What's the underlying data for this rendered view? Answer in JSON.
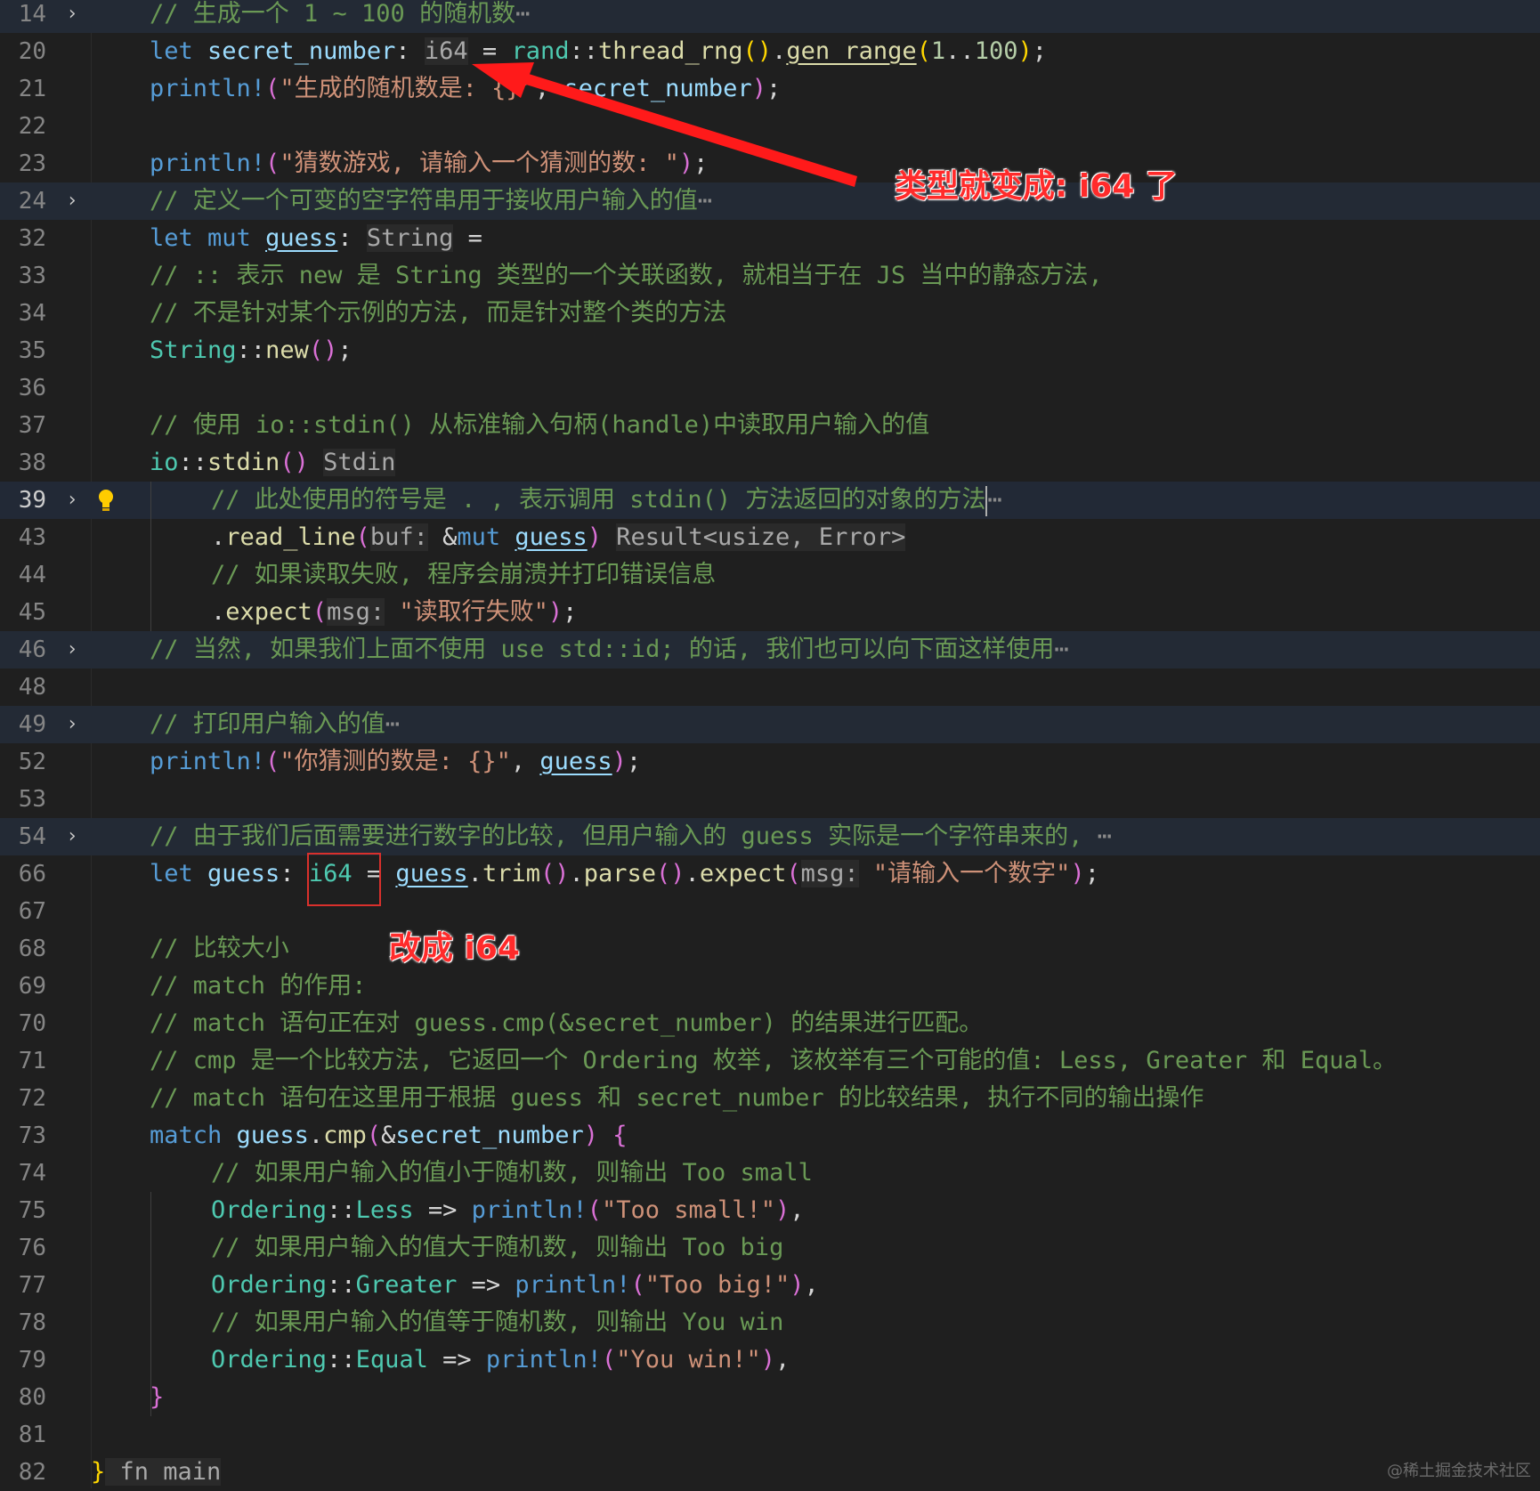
{
  "editor": {
    "lines": [
      {
        "n": "14",
        "fold": true,
        "folded_bg": true,
        "indent": 1,
        "tokens": [
          [
            "t-cm",
            "// 生成一个 1 ~ 100 的随机数"
          ],
          [
            "ell",
            "⋯"
          ]
        ]
      },
      {
        "n": "20",
        "indent": 1,
        "tokens": [
          [
            "t-kw",
            "let "
          ],
          [
            "t-var",
            "secret_number"
          ],
          [
            "",
            ": "
          ],
          [
            "t-hint",
            "i64"
          ],
          [
            "",
            " = "
          ],
          [
            "t-type",
            "rand"
          ],
          [
            "",
            "::"
          ],
          [
            "t-fn",
            "thread_rng"
          ],
          [
            "t-yb",
            "()"
          ],
          [
            "",
            "."
          ],
          [
            "t-fn ul",
            "gen_range"
          ],
          [
            "t-yb",
            "("
          ],
          [
            "t-num",
            "1"
          ],
          [
            "",
            ".."
          ],
          [
            "t-num",
            "100"
          ],
          [
            "t-yb",
            ")"
          ],
          [
            "",
            ";"
          ]
        ]
      },
      {
        "n": "21",
        "indent": 1,
        "tokens": [
          [
            "t-kw",
            "println!"
          ],
          [
            "t-paren",
            "("
          ],
          [
            "t-str",
            "\"生成的随机数是: {}\""
          ],
          [
            "",
            ", "
          ],
          [
            "t-var",
            "secret_number"
          ],
          [
            "t-paren",
            ")"
          ],
          [
            "",
            ";"
          ]
        ]
      },
      {
        "n": "22",
        "indent": 1,
        "tokens": []
      },
      {
        "n": "23",
        "indent": 1,
        "tokens": [
          [
            "t-kw",
            "println!"
          ],
          [
            "t-paren",
            "("
          ],
          [
            "t-str",
            "\"猜数游戏, 请输入一个猜测的数: \""
          ],
          [
            "t-paren",
            ")"
          ],
          [
            "",
            ";"
          ]
        ]
      },
      {
        "n": "24",
        "fold": true,
        "folded_bg": true,
        "indent": 1,
        "tokens": [
          [
            "t-cm",
            "// 定义一个可变的空字符串用于接收用户输入的值"
          ],
          [
            "ell",
            "⋯"
          ]
        ]
      },
      {
        "n": "32",
        "indent": 1,
        "tokens": [
          [
            "t-kw",
            "let "
          ],
          [
            "t-kw",
            "mut "
          ],
          [
            "t-var ul",
            "guess"
          ],
          [
            "",
            ": "
          ],
          [
            "t-hint",
            "String"
          ],
          [
            "",
            " ="
          ]
        ]
      },
      {
        "n": "33",
        "indent": 1,
        "tokens": [
          [
            "t-cm",
            "// :: 表示 new 是 String 类型的一个关联函数, 就相当于在 JS 当中的静态方法,"
          ]
        ]
      },
      {
        "n": "34",
        "indent": 1,
        "tokens": [
          [
            "t-cm",
            "// 不是针对某个示例的方法, 而是针对整个类的方法"
          ]
        ]
      },
      {
        "n": "35",
        "indent": 1,
        "tokens": [
          [
            "t-type",
            "String"
          ],
          [
            "",
            "::"
          ],
          [
            "t-fn",
            "new"
          ],
          [
            "t-paren",
            "()"
          ],
          [
            "",
            ";"
          ]
        ]
      },
      {
        "n": "36",
        "indent": 1,
        "tokens": []
      },
      {
        "n": "37",
        "indent": 1,
        "tokens": [
          [
            "t-cm",
            "// 使用 io::stdin() 从标准输入句柄(handle)中读取用户输入的值"
          ]
        ]
      },
      {
        "n": "38",
        "indent": 1,
        "tokens": [
          [
            "t-type",
            "io"
          ],
          [
            "",
            "::"
          ],
          [
            "t-fn",
            "stdin"
          ],
          [
            "t-paren",
            "()"
          ],
          [
            "",
            " "
          ],
          [
            "t-hint",
            "Stdin"
          ]
        ]
      },
      {
        "n": "39",
        "fold": true,
        "current": true,
        "active": true,
        "bulb": true,
        "indent": 2,
        "tokens": [
          [
            "t-cm",
            "// 此处使用的符号是 . , 表示调用 stdin() 方法返回的对象的方法"
          ],
          [
            "cursor",
            ""
          ],
          [
            "ell",
            "⋯"
          ]
        ]
      },
      {
        "n": "43",
        "indent": 2,
        "tokens": [
          [
            "",
            "."
          ],
          [
            "t-fn",
            "read_line"
          ],
          [
            "t-paren",
            "("
          ],
          [
            "t-hint",
            "buf:"
          ],
          [
            "",
            " &"
          ],
          [
            "t-kw",
            "mut "
          ],
          [
            "t-var ul",
            "guess"
          ],
          [
            "t-paren",
            ")"
          ],
          [
            "",
            " "
          ],
          [
            "t-hint",
            "Result<usize, Error>"
          ]
        ]
      },
      {
        "n": "44",
        "indent": 2,
        "tokens": [
          [
            "t-cm",
            "// 如果读取失败, 程序会崩溃并打印错误信息"
          ]
        ]
      },
      {
        "n": "45",
        "indent": 2,
        "tokens": [
          [
            "",
            "."
          ],
          [
            "t-fn",
            "expect"
          ],
          [
            "t-paren",
            "("
          ],
          [
            "t-hint",
            "msg:"
          ],
          [
            "",
            " "
          ],
          [
            "t-str",
            "\"读取行失败\""
          ],
          [
            "t-paren",
            ")"
          ],
          [
            "",
            ";"
          ]
        ]
      },
      {
        "n": "46",
        "fold": true,
        "folded_bg": true,
        "indent": 1,
        "tokens": [
          [
            "t-cm",
            "// 当然, 如果我们上面不使用 use std::id; 的话, 我们也可以向下面这样使用"
          ],
          [
            "ell",
            "⋯"
          ]
        ]
      },
      {
        "n": "48",
        "indent": 1,
        "tokens": []
      },
      {
        "n": "49",
        "fold": true,
        "folded_bg": true,
        "indent": 1,
        "tokens": [
          [
            "t-cm",
            "// 打印用户输入的值"
          ],
          [
            "ell",
            "⋯"
          ]
        ]
      },
      {
        "n": "52",
        "indent": 1,
        "tokens": [
          [
            "t-kw",
            "println!"
          ],
          [
            "t-paren",
            "("
          ],
          [
            "t-str",
            "\"你猜测的数是: {}\""
          ],
          [
            "",
            ", "
          ],
          [
            "t-var ul",
            "guess"
          ],
          [
            "t-paren",
            ")"
          ],
          [
            "",
            ";"
          ]
        ]
      },
      {
        "n": "53",
        "indent": 1,
        "tokens": []
      },
      {
        "n": "54",
        "fold": true,
        "folded_bg": true,
        "indent": 1,
        "tokens": [
          [
            "t-cm",
            "// 由于我们后面需要进行数字的比较, 但用户输入的 guess 实际是一个字符串来的, "
          ],
          [
            "ell",
            "⋯"
          ]
        ]
      },
      {
        "n": "66",
        "indent": 1,
        "tokens": [
          [
            "t-kw",
            "let "
          ],
          [
            "t-var",
            "guess"
          ],
          [
            "",
            ": "
          ],
          [
            "t-type",
            "i64"
          ],
          [
            "",
            " = "
          ],
          [
            "t-var ul",
            "guess"
          ],
          [
            "",
            "."
          ],
          [
            "t-fn",
            "trim"
          ],
          [
            "t-paren",
            "()"
          ],
          [
            "",
            "."
          ],
          [
            "t-fn",
            "parse"
          ],
          [
            "t-paren",
            "()"
          ],
          [
            "",
            "."
          ],
          [
            "t-fn",
            "expect"
          ],
          [
            "t-paren",
            "("
          ],
          [
            "t-hint",
            "msg:"
          ],
          [
            "",
            " "
          ],
          [
            "t-str",
            "\"请输入一个数字\""
          ],
          [
            "t-paren",
            ")"
          ],
          [
            "",
            ";"
          ]
        ]
      },
      {
        "n": "67",
        "indent": 1,
        "tokens": []
      },
      {
        "n": "68",
        "indent": 1,
        "tokens": [
          [
            "t-cm",
            "// 比较大小"
          ]
        ]
      },
      {
        "n": "69",
        "indent": 1,
        "tokens": [
          [
            "t-cm",
            "// match 的作用:"
          ]
        ]
      },
      {
        "n": "70",
        "indent": 1,
        "tokens": [
          [
            "t-cm",
            "// match 语句正在对 guess.cmp(&secret_number) 的结果进行匹配。"
          ]
        ]
      },
      {
        "n": "71",
        "indent": 1,
        "tokens": [
          [
            "t-cm",
            "// cmp 是一个比较方法, 它返回一个 Ordering 枚举, 该枚举有三个可能的值: Less, Greater 和 Equal。"
          ]
        ]
      },
      {
        "n": "72",
        "indent": 1,
        "tokens": [
          [
            "t-cm",
            "// match 语句在这里用于根据 guess 和 secret_number 的比较结果, 执行不同的输出操作"
          ]
        ]
      },
      {
        "n": "73",
        "indent": 1,
        "tokens": [
          [
            "t-kw",
            "match "
          ],
          [
            "t-var",
            "guess"
          ],
          [
            "",
            "."
          ],
          [
            "t-fn",
            "cmp"
          ],
          [
            "t-paren",
            "("
          ],
          [
            "",
            "&"
          ],
          [
            "t-var",
            "secret_number"
          ],
          [
            "t-paren",
            ")"
          ],
          [
            "",
            " "
          ],
          [
            "t-brace",
            "{"
          ]
        ]
      },
      {
        "n": "74",
        "indent": 2,
        "tokens": [
          [
            "t-cm",
            "// 如果用户输入的值小于随机数, 则输出 Too small"
          ]
        ]
      },
      {
        "n": "75",
        "indent": 2,
        "tokens": [
          [
            "t-type",
            "Ordering"
          ],
          [
            "",
            "::"
          ],
          [
            "t-type",
            "Less"
          ],
          [
            "",
            " => "
          ],
          [
            "t-kw",
            "println!"
          ],
          [
            "t-paren",
            "("
          ],
          [
            "t-str",
            "\"Too small!\""
          ],
          [
            "t-paren",
            ")"
          ],
          [
            "",
            ","
          ]
        ]
      },
      {
        "n": "76",
        "indent": 2,
        "tokens": [
          [
            "t-cm",
            "// 如果用户输入的值大于随机数, 则输出 Too big"
          ]
        ]
      },
      {
        "n": "77",
        "indent": 2,
        "tokens": [
          [
            "t-type",
            "Ordering"
          ],
          [
            "",
            "::"
          ],
          [
            "t-type",
            "Greater"
          ],
          [
            "",
            " => "
          ],
          [
            "t-kw",
            "println!"
          ],
          [
            "t-paren",
            "("
          ],
          [
            "t-str",
            "\"Too big!\""
          ],
          [
            "t-paren",
            ")"
          ],
          [
            "",
            ","
          ]
        ]
      },
      {
        "n": "78",
        "indent": 2,
        "tokens": [
          [
            "t-cm",
            "// 如果用户输入的值等于随机数, 则输出 You win"
          ]
        ]
      },
      {
        "n": "79",
        "indent": 2,
        "tokens": [
          [
            "t-type",
            "Ordering"
          ],
          [
            "",
            "::"
          ],
          [
            "t-type",
            "Equal"
          ],
          [
            "",
            " => "
          ],
          [
            "t-kw",
            "println!"
          ],
          [
            "t-paren",
            "("
          ],
          [
            "t-str",
            "\"You win!\""
          ],
          [
            "t-paren",
            ")"
          ],
          [
            "",
            ","
          ]
        ]
      },
      {
        "n": "80",
        "indent": 1,
        "tokens": [
          [
            "t-brace",
            "}"
          ]
        ]
      },
      {
        "n": "81",
        "indent": 1,
        "tokens": []
      },
      {
        "n": "82",
        "indent": 0,
        "tokens": [
          [
            "t-yb",
            "}"
          ],
          [
            "t-hint",
            " fn main"
          ]
        ]
      }
    ]
  },
  "annotations": {
    "type_changed": "类型就变成: i64 了",
    "changed_to": "改成 i64"
  },
  "watermark": "@稀土掘金技术社区",
  "colors": {
    "background": "#1f1f1f",
    "annotation_red": "#ff2b2b",
    "highlight_box": "#d9302c"
  }
}
